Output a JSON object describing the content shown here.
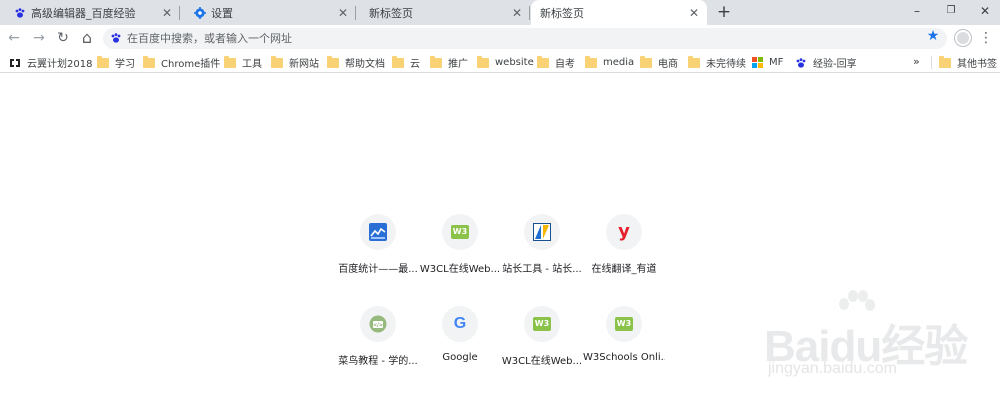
{
  "tabs": [
    {
      "title": "高级编辑器_百度经验",
      "icon": "baidu-paw-icon",
      "active": false
    },
    {
      "title": "设置",
      "icon": "gear-icon",
      "active": false
    },
    {
      "title": "新标签页",
      "icon": "",
      "active": false
    },
    {
      "title": "新标签页",
      "icon": "",
      "active": true
    }
  ],
  "tab_close_glyph": "✕",
  "new_tab_glyph": "+",
  "window_controls": {
    "minimize": "–",
    "restore": "❐",
    "close": "✕"
  },
  "toolbar": {
    "back": "←",
    "forward": "→",
    "reload": "↻",
    "home": "⌂",
    "omnibox_placeholder": "在百度中搜索，或者输入一个网址",
    "star": "★",
    "menu": "⋮"
  },
  "bookmarks": [
    {
      "label": "云翼计划2018",
      "icon": "cloud-logo-icon"
    },
    {
      "label": "学习",
      "icon": "folder-icon"
    },
    {
      "label": "Chrome插件",
      "icon": "folder-icon"
    },
    {
      "label": "工具",
      "icon": "folder-icon"
    },
    {
      "label": "新网站",
      "icon": "folder-icon"
    },
    {
      "label": "帮助文档",
      "icon": "folder-icon"
    },
    {
      "label": "云",
      "icon": "folder-icon"
    },
    {
      "label": "推广",
      "icon": "folder-icon"
    },
    {
      "label": "website",
      "icon": "folder-icon"
    },
    {
      "label": "自考",
      "icon": "folder-icon"
    },
    {
      "label": "media",
      "icon": "folder-icon"
    },
    {
      "label": "电商",
      "icon": "folder-icon"
    },
    {
      "label": "未完待续",
      "icon": "folder-icon"
    },
    {
      "label": "MF",
      "icon": "microsoft-logo-icon"
    },
    {
      "label": "经验-回享",
      "icon": "baidu-paw-icon"
    }
  ],
  "bookmarks_overflow": "»",
  "other_bookmarks": "其他书签",
  "tiles": [
    {
      "label": "百度统计——最...",
      "icon": "baidu-tongji-icon"
    },
    {
      "label": "W3CL在线Web...",
      "icon": "w3-icon"
    },
    {
      "label": "站长工具 - 站长...",
      "icon": "chinaz-icon"
    },
    {
      "label": "在线翻译_有道",
      "icon": "youdao-icon"
    },
    {
      "label": "菜鸟教程 - 学的...",
      "icon": "runoob-icon"
    },
    {
      "label": "Google",
      "icon": "google-g-icon"
    },
    {
      "label": "W3CL在线Web...",
      "icon": "w3-icon"
    },
    {
      "label": "W3Schools Onli...",
      "icon": "w3-icon"
    }
  ],
  "w3_badge": "W3",
  "youdao_glyph": "y",
  "google_glyph": "G",
  "watermark": {
    "main": "Baidu经验",
    "sub": "jingyan.baidu.com"
  },
  "colors": {
    "tabstrip": "#dee1e6",
    "accent_blue": "#1a73e8",
    "w3_green": "#8bc34a",
    "folder": "#f9d276"
  }
}
